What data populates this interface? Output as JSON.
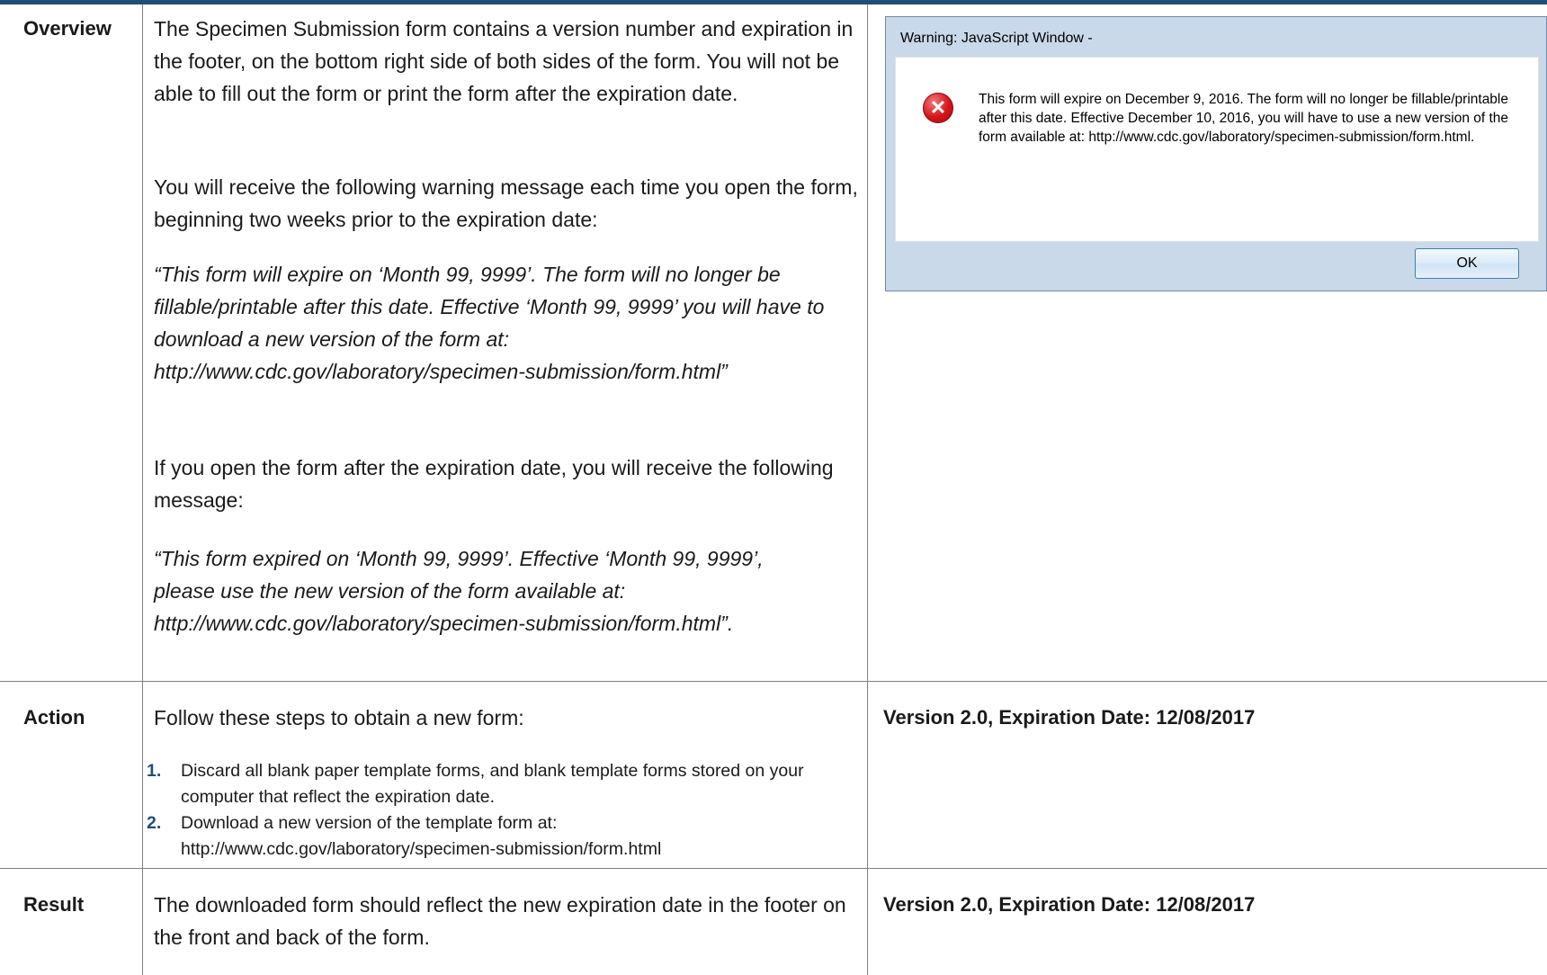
{
  "rows": {
    "overview": {
      "label": "Overview",
      "para1": "The Specimen Submission form contains a version number and expiration in the footer, on the bottom right side of both sides of the form. You will not be able to fill out the form or print the form after the expiration date.",
      "para2": "You will receive the following warning message each time you open the form, beginning two weeks prior to the expiration date:",
      "quote1": "“This form will expire on ‘Month 99, 9999’. The form will no longer be fillable/printable after this date. Effective ‘Month 99, 9999’ you will have to download a new version of the form at: http://www.cdc.gov/laboratory/specimen-submission/form.html”",
      "para3": "If you open the form after the expiration date, you will receive the following message:",
      "quote2": "“This form expired on ‘Month 99, 9999’. Effective ‘Month 99, 9999’, please use the new version of the form available at: http://www.cdc.gov/laboratory/specimen-submission/form.html”."
    },
    "action": {
      "label": "Action",
      "intro": "Follow these steps to obtain a new form:",
      "steps": [
        {
          "num": "1.",
          "text": "Discard all blank paper template forms, and blank template forms stored on your computer that reflect the expiration date."
        },
        {
          "num": "2.",
          "text": "Download a new version of the template form at: http://www.cdc.gov/laboratory/specimen-submission/form.html"
        }
      ],
      "version": "Version 2.0, Expiration Date: 12/08/2017"
    },
    "result": {
      "label": "Result",
      "text": "The downloaded form should reflect the new expiration date in the footer on the front and back of the form.",
      "version": "Version 2.0, Expiration Date: 12/08/2017"
    }
  },
  "dialog": {
    "title": "Warning: JavaScript Window -",
    "icon": "error-x-icon",
    "message": "This form will expire on December 9, 2016.  The form will no longer be fillable/printable after this date.  Effective December 10, 2016, you will have to use a new version of the form available at: http://www.cdc.gov/laboratory/specimen-submission/form.html.",
    "ok_label": "OK"
  },
  "colors": {
    "accent": "#1f4e79",
    "dialog_frame": "#c9d9ea"
  }
}
